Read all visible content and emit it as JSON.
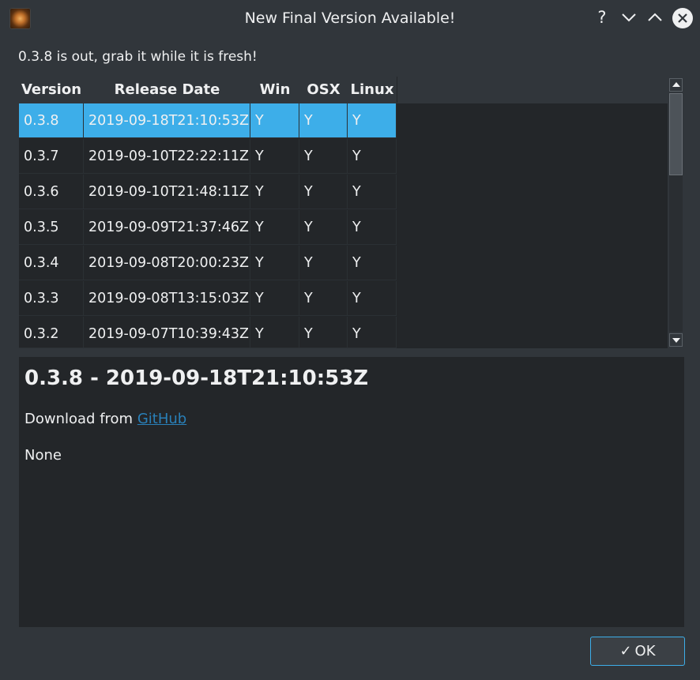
{
  "window": {
    "title": "New Final Version Available!",
    "help_icon": "?",
    "minimize_icon": "chevron-down",
    "maximize_icon": "chevron-up",
    "close_icon": "close"
  },
  "intro": "0.3.8 is out, grab it while it is fresh!",
  "table": {
    "headers": [
      "Version",
      "Release Date",
      "Win",
      "OSX",
      "Linux"
    ],
    "rows": [
      {
        "version": "0.3.8",
        "date": "2019-09-18T21:10:53Z",
        "win": "Y",
        "osx": "Y",
        "linux": "Y"
      },
      {
        "version": "0.3.7",
        "date": "2019-09-10T22:22:11Z",
        "win": "Y",
        "osx": "Y",
        "linux": "Y"
      },
      {
        "version": "0.3.6",
        "date": "2019-09-10T21:48:11Z",
        "win": "Y",
        "osx": "Y",
        "linux": "Y"
      },
      {
        "version": "0.3.5",
        "date": "2019-09-09T21:37:46Z",
        "win": "Y",
        "osx": "Y",
        "linux": "Y"
      },
      {
        "version": "0.3.4",
        "date": "2019-09-08T20:00:23Z",
        "win": "Y",
        "osx": "Y",
        "linux": "Y"
      },
      {
        "version": "0.3.3",
        "date": "2019-09-08T13:15:03Z",
        "win": "Y",
        "osx": "Y",
        "linux": "Y"
      },
      {
        "version": "0.3.2",
        "date": "2019-09-07T10:39:43Z",
        "win": "Y",
        "osx": "Y",
        "linux": "Y"
      }
    ],
    "selected_index": 0
  },
  "details": {
    "heading": "0.3.8 - 2019-09-18T21:10:53Z",
    "download_prefix": "Download from ",
    "download_link": "GitHub",
    "notes": "None"
  },
  "ok_button": {
    "label": "OK",
    "icon": "✓"
  },
  "colors": {
    "background": "#31363b",
    "panel": "#232629",
    "selection": "#3daee9",
    "link": "#2980b9",
    "text": "#eff0f1"
  }
}
